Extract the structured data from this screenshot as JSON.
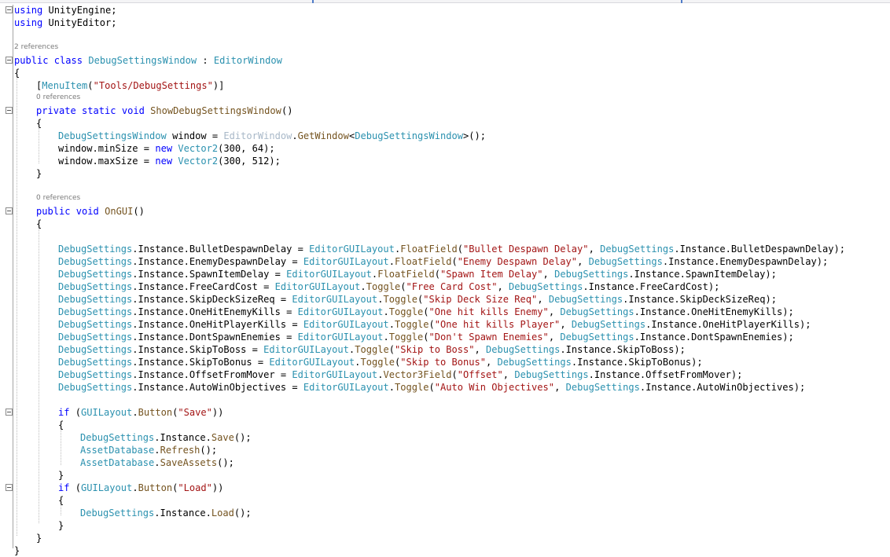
{
  "editor": {
    "lines": [
      {
        "kind": "code",
        "col": 1,
        "fold": true,
        "tokens": [
          [
            "kw",
            "using"
          ],
          [
            "txt",
            " UnityEngine;"
          ]
        ]
      },
      {
        "kind": "code",
        "col": 1,
        "tokens": [
          [
            "kw",
            "using"
          ],
          [
            "txt",
            " UnityEditor;"
          ]
        ]
      },
      {
        "kind": "blank"
      },
      {
        "kind": "ref",
        "col": 1,
        "text": "2 references"
      },
      {
        "kind": "code",
        "col": 1,
        "fold": true,
        "tokens": [
          [
            "kw",
            "public"
          ],
          [
            "txt",
            " "
          ],
          [
            "kw",
            "class"
          ],
          [
            "txt",
            " "
          ],
          [
            "type",
            "DebugSettingsWindow"
          ],
          [
            "txt",
            " : "
          ],
          [
            "type",
            "EditorWindow"
          ]
        ]
      },
      {
        "kind": "code",
        "col": 1,
        "tokens": [
          [
            "txt",
            "{"
          ]
        ]
      },
      {
        "kind": "code",
        "col": 5,
        "tokens": [
          [
            "txt",
            "["
          ],
          [
            "type",
            "MenuItem"
          ],
          [
            "txt",
            "("
          ],
          [
            "str",
            "\"Tools/DebugSettings\""
          ],
          [
            "txt",
            ")]"
          ]
        ]
      },
      {
        "kind": "ref",
        "col": 5,
        "text": "0 references"
      },
      {
        "kind": "code",
        "col": 5,
        "fold": true,
        "tokens": [
          [
            "kw",
            "private"
          ],
          [
            "txt",
            " "
          ],
          [
            "kw",
            "static"
          ],
          [
            "txt",
            " "
          ],
          [
            "kw",
            "void"
          ],
          [
            "txt",
            " "
          ],
          [
            "method",
            "ShowDebugSettingsWindow"
          ],
          [
            "txt",
            "()"
          ]
        ]
      },
      {
        "kind": "code",
        "col": 5,
        "tokens": [
          [
            "txt",
            "{"
          ]
        ]
      },
      {
        "kind": "code",
        "col": 9,
        "tokens": [
          [
            "type",
            "DebugSettingsWindow"
          ],
          [
            "txt",
            " window = "
          ],
          [
            "gray",
            "EditorWindow"
          ],
          [
            "txt",
            "."
          ],
          [
            "method",
            "GetWindow"
          ],
          [
            "txt",
            "<"
          ],
          [
            "type",
            "DebugSettingsWindow"
          ],
          [
            "txt",
            ">();"
          ]
        ]
      },
      {
        "kind": "code",
        "col": 9,
        "tokens": [
          [
            "txt",
            "window.minSize = "
          ],
          [
            "kw",
            "new"
          ],
          [
            "txt",
            " "
          ],
          [
            "type",
            "Vector2"
          ],
          [
            "txt",
            "(300, 64);"
          ]
        ]
      },
      {
        "kind": "code",
        "col": 9,
        "tokens": [
          [
            "txt",
            "window.maxSize = "
          ],
          [
            "kw",
            "new"
          ],
          [
            "txt",
            " "
          ],
          [
            "type",
            "Vector2"
          ],
          [
            "txt",
            "(300, 512);"
          ]
        ]
      },
      {
        "kind": "code",
        "col": 5,
        "tokens": [
          [
            "txt",
            "}"
          ]
        ]
      },
      {
        "kind": "blank"
      },
      {
        "kind": "ref",
        "col": 5,
        "text": "0 references"
      },
      {
        "kind": "code",
        "col": 5,
        "fold": true,
        "tokens": [
          [
            "kw",
            "public"
          ],
          [
            "txt",
            " "
          ],
          [
            "kw",
            "void"
          ],
          [
            "txt",
            " "
          ],
          [
            "method",
            "OnGUI"
          ],
          [
            "txt",
            "()"
          ]
        ]
      },
      {
        "kind": "code",
        "col": 5,
        "tokens": [
          [
            "txt",
            "{"
          ]
        ]
      },
      {
        "kind": "blank"
      },
      {
        "kind": "code",
        "col": 9,
        "tokens": [
          [
            "type",
            "DebugSettings"
          ],
          [
            "txt",
            ".Instance.BulletDespawnDelay = "
          ],
          [
            "type",
            "EditorGUILayout"
          ],
          [
            "txt",
            "."
          ],
          [
            "method",
            "FloatField"
          ],
          [
            "txt",
            "("
          ],
          [
            "str",
            "\"Bullet Despawn Delay\""
          ],
          [
            "txt",
            ", "
          ],
          [
            "type",
            "DebugSettings"
          ],
          [
            "txt",
            ".Instance.BulletDespawnDelay);"
          ]
        ]
      },
      {
        "kind": "code",
        "col": 9,
        "tokens": [
          [
            "type",
            "DebugSettings"
          ],
          [
            "txt",
            ".Instance.EnemyDespawnDelay = "
          ],
          [
            "type",
            "EditorGUILayout"
          ],
          [
            "txt",
            "."
          ],
          [
            "method",
            "FloatField"
          ],
          [
            "txt",
            "("
          ],
          [
            "str",
            "\"Enemy Despawn Delay\""
          ],
          [
            "txt",
            ", "
          ],
          [
            "type",
            "DebugSettings"
          ],
          [
            "txt",
            ".Instance.EnemyDespawnDelay);"
          ]
        ]
      },
      {
        "kind": "code",
        "col": 9,
        "tokens": [
          [
            "type",
            "DebugSettings"
          ],
          [
            "txt",
            ".Instance.SpawnItemDelay = "
          ],
          [
            "type",
            "EditorGUILayout"
          ],
          [
            "txt",
            "."
          ],
          [
            "method",
            "FloatField"
          ],
          [
            "txt",
            "("
          ],
          [
            "str",
            "\"Spawn Item Delay\""
          ],
          [
            "txt",
            ", "
          ],
          [
            "type",
            "DebugSettings"
          ],
          [
            "txt",
            ".Instance.SpawnItemDelay);"
          ]
        ]
      },
      {
        "kind": "code",
        "col": 9,
        "tokens": [
          [
            "type",
            "DebugSettings"
          ],
          [
            "txt",
            ".Instance.FreeCardCost = "
          ],
          [
            "type",
            "EditorGUILayout"
          ],
          [
            "txt",
            "."
          ],
          [
            "method",
            "Toggle"
          ],
          [
            "txt",
            "("
          ],
          [
            "str",
            "\"Free Card Cost\""
          ],
          [
            "txt",
            ", "
          ],
          [
            "type",
            "DebugSettings"
          ],
          [
            "txt",
            ".Instance.FreeCardCost);"
          ]
        ]
      },
      {
        "kind": "code",
        "col": 9,
        "tokens": [
          [
            "type",
            "DebugSettings"
          ],
          [
            "txt",
            ".Instance.SkipDeckSizeReq = "
          ],
          [
            "type",
            "EditorGUILayout"
          ],
          [
            "txt",
            "."
          ],
          [
            "method",
            "Toggle"
          ],
          [
            "txt",
            "("
          ],
          [
            "str",
            "\"Skip Deck Size Req\""
          ],
          [
            "txt",
            ", "
          ],
          [
            "type",
            "DebugSettings"
          ],
          [
            "txt",
            ".Instance.SkipDeckSizeReq);"
          ]
        ]
      },
      {
        "kind": "code",
        "col": 9,
        "tokens": [
          [
            "type",
            "DebugSettings"
          ],
          [
            "txt",
            ".Instance.OneHitEnemyKills = "
          ],
          [
            "type",
            "EditorGUILayout"
          ],
          [
            "txt",
            "."
          ],
          [
            "method",
            "Toggle"
          ],
          [
            "txt",
            "("
          ],
          [
            "str",
            "\"One hit kills Enemy\""
          ],
          [
            "txt",
            ", "
          ],
          [
            "type",
            "DebugSettings"
          ],
          [
            "txt",
            ".Instance.OneHitEnemyKills);"
          ]
        ]
      },
      {
        "kind": "code",
        "col": 9,
        "tokens": [
          [
            "type",
            "DebugSettings"
          ],
          [
            "txt",
            ".Instance.OneHitPlayerKills = "
          ],
          [
            "type",
            "EditorGUILayout"
          ],
          [
            "txt",
            "."
          ],
          [
            "method",
            "Toggle"
          ],
          [
            "txt",
            "("
          ],
          [
            "str",
            "\"One hit kills Player\""
          ],
          [
            "txt",
            ", "
          ],
          [
            "type",
            "DebugSettings"
          ],
          [
            "txt",
            ".Instance.OneHitPlayerKills);"
          ]
        ]
      },
      {
        "kind": "code",
        "col": 9,
        "tokens": [
          [
            "type",
            "DebugSettings"
          ],
          [
            "txt",
            ".Instance.DontSpawnEnemies = "
          ],
          [
            "type",
            "EditorGUILayout"
          ],
          [
            "txt",
            "."
          ],
          [
            "method",
            "Toggle"
          ],
          [
            "txt",
            "("
          ],
          [
            "str",
            "\"Don't Spawn Enemies\""
          ],
          [
            "txt",
            ", "
          ],
          [
            "type",
            "DebugSettings"
          ],
          [
            "txt",
            ".Instance.DontSpawnEnemies);"
          ]
        ]
      },
      {
        "kind": "code",
        "col": 9,
        "tokens": [
          [
            "type",
            "DebugSettings"
          ],
          [
            "txt",
            ".Instance.SkipToBoss = "
          ],
          [
            "type",
            "EditorGUILayout"
          ],
          [
            "txt",
            "."
          ],
          [
            "method",
            "Toggle"
          ],
          [
            "txt",
            "("
          ],
          [
            "str",
            "\"Skip to Boss\""
          ],
          [
            "txt",
            ", "
          ],
          [
            "type",
            "DebugSettings"
          ],
          [
            "txt",
            ".Instance.SkipToBoss);"
          ]
        ]
      },
      {
        "kind": "code",
        "col": 9,
        "tokens": [
          [
            "type",
            "DebugSettings"
          ],
          [
            "txt",
            ".Instance.SkipToBonus = "
          ],
          [
            "type",
            "EditorGUILayout"
          ],
          [
            "txt",
            "."
          ],
          [
            "method",
            "Toggle"
          ],
          [
            "txt",
            "("
          ],
          [
            "str",
            "\"Skip to Bonus\""
          ],
          [
            "txt",
            ", "
          ],
          [
            "type",
            "DebugSettings"
          ],
          [
            "txt",
            ".Instance.SkipToBonus);"
          ]
        ]
      },
      {
        "kind": "code",
        "col": 9,
        "tokens": [
          [
            "type",
            "DebugSettings"
          ],
          [
            "txt",
            ".Instance.OffsetFromMover = "
          ],
          [
            "type",
            "EditorGUILayout"
          ],
          [
            "txt",
            "."
          ],
          [
            "method",
            "Vector3Field"
          ],
          [
            "txt",
            "("
          ],
          [
            "str",
            "\"Offset\""
          ],
          [
            "txt",
            ", "
          ],
          [
            "type",
            "DebugSettings"
          ],
          [
            "txt",
            ".Instance.OffsetFromMover);"
          ]
        ]
      },
      {
        "kind": "code",
        "col": 9,
        "tokens": [
          [
            "type",
            "DebugSettings"
          ],
          [
            "txt",
            ".Instance.AutoWinObjectives = "
          ],
          [
            "type",
            "EditorGUILayout"
          ],
          [
            "txt",
            "."
          ],
          [
            "method",
            "Toggle"
          ],
          [
            "txt",
            "("
          ],
          [
            "str",
            "\"Auto Win Objectives\""
          ],
          [
            "txt",
            ", "
          ],
          [
            "type",
            "DebugSettings"
          ],
          [
            "txt",
            ".Instance.AutoWinObjectives);"
          ]
        ]
      },
      {
        "kind": "blank"
      },
      {
        "kind": "code",
        "col": 9,
        "fold": true,
        "tokens": [
          [
            "kw",
            "if"
          ],
          [
            "txt",
            " ("
          ],
          [
            "type",
            "GUILayout"
          ],
          [
            "txt",
            "."
          ],
          [
            "method",
            "Button"
          ],
          [
            "txt",
            "("
          ],
          [
            "str",
            "\"Save\""
          ],
          [
            "txt",
            "))"
          ]
        ]
      },
      {
        "kind": "code",
        "col": 9,
        "tokens": [
          [
            "txt",
            "{"
          ]
        ]
      },
      {
        "kind": "code",
        "col": 13,
        "tokens": [
          [
            "type",
            "DebugSettings"
          ],
          [
            "txt",
            ".Instance."
          ],
          [
            "method",
            "Save"
          ],
          [
            "txt",
            "();"
          ]
        ]
      },
      {
        "kind": "code",
        "col": 13,
        "tokens": [
          [
            "type",
            "AssetDatabase"
          ],
          [
            "txt",
            "."
          ],
          [
            "method",
            "Refresh"
          ],
          [
            "txt",
            "();"
          ]
        ]
      },
      {
        "kind": "code",
        "col": 13,
        "tokens": [
          [
            "type",
            "AssetDatabase"
          ],
          [
            "txt",
            "."
          ],
          [
            "method",
            "SaveAssets"
          ],
          [
            "txt",
            "();"
          ]
        ]
      },
      {
        "kind": "code",
        "col": 9,
        "tokens": [
          [
            "txt",
            "}"
          ]
        ]
      },
      {
        "kind": "code",
        "col": 9,
        "fold": true,
        "tokens": [
          [
            "kw",
            "if"
          ],
          [
            "txt",
            " ("
          ],
          [
            "type",
            "GUILayout"
          ],
          [
            "txt",
            "."
          ],
          [
            "method",
            "Button"
          ],
          [
            "txt",
            "("
          ],
          [
            "str",
            "\"Load\""
          ],
          [
            "txt",
            "))"
          ]
        ]
      },
      {
        "kind": "code",
        "col": 9,
        "tokens": [
          [
            "txt",
            "{"
          ]
        ]
      },
      {
        "kind": "code",
        "col": 13,
        "tokens": [
          [
            "type",
            "DebugSettings"
          ],
          [
            "txt",
            ".Instance."
          ],
          [
            "method",
            "Load"
          ],
          [
            "txt",
            "();"
          ]
        ]
      },
      {
        "kind": "code",
        "col": 9,
        "tokens": [
          [
            "txt",
            "}"
          ]
        ]
      },
      {
        "kind": "code",
        "col": 5,
        "tokens": [
          [
            "txt",
            "}"
          ]
        ]
      },
      {
        "kind": "code",
        "col": 1,
        "tokens": [
          [
            "txt",
            "}"
          ]
        ]
      }
    ]
  },
  "colors": {
    "keyword": "#0000ff",
    "type": "#2b91af",
    "string": "#a31515",
    "text": "#000000",
    "method": "#74531f",
    "grayed": "#a8b8c8",
    "reference_lens": "#7a7a7a"
  }
}
